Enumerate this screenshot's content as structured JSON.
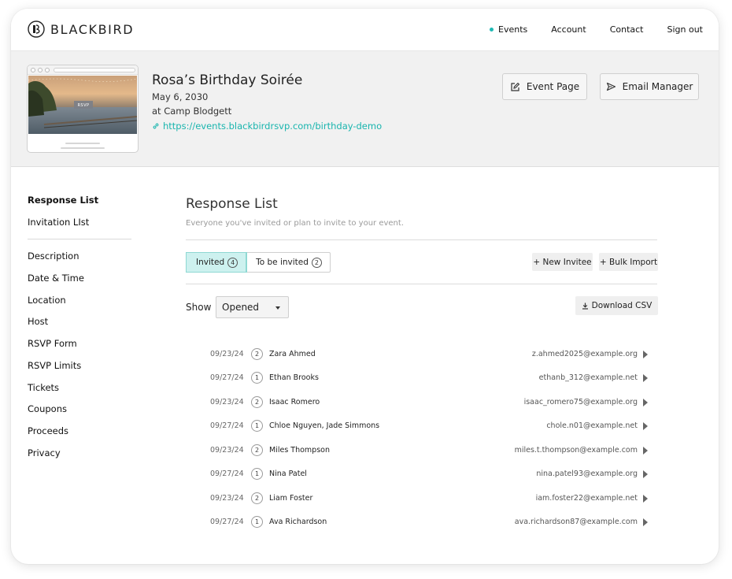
{
  "brand": {
    "name": "BLACKBIRD"
  },
  "nav": [
    {
      "label": "Events",
      "active": true
    },
    {
      "label": "Account"
    },
    {
      "label": "Contact"
    },
    {
      "label": "Sign out"
    }
  ],
  "event": {
    "thumbnail_badge": "RSVP",
    "title": "Rosa’s Birthday Soirée",
    "date": "May 6, 2030",
    "venue": "at Camp Blodgett",
    "url": "https://events.blackbirdrsvp.com/birthday-demo"
  },
  "header_buttons": {
    "event_page": "Event Page",
    "email_manager": "Email Manager"
  },
  "sidebar": {
    "primary": [
      {
        "label": "Response List",
        "active": true
      },
      {
        "label": "Invitation LIst"
      }
    ],
    "secondary": [
      {
        "label": "Description"
      },
      {
        "label": "Date & Time"
      },
      {
        "label": "Location"
      },
      {
        "label": "Host"
      },
      {
        "label": "RSVP Form"
      },
      {
        "label": "RSVP Limits"
      },
      {
        "label": "Tickets"
      },
      {
        "label": "Coupons"
      },
      {
        "label": "Proceeds"
      },
      {
        "label": "Privacy"
      }
    ]
  },
  "main": {
    "title": "Response List",
    "subtitle": "Everyone you've invited or plan to invite to your event.",
    "tabs": [
      {
        "label": "Invited",
        "count": "4",
        "active": true
      },
      {
        "label": "To be invited",
        "count": "2"
      }
    ],
    "new_invitee": "+ New Invitee",
    "bulk_import": "+ Bulk Import",
    "show_label": "Show",
    "filter_value": "Opened",
    "download_csv": "Download CSV"
  },
  "responses": [
    {
      "date": "09/23/24",
      "count": "2",
      "name": "Zara Ahmed",
      "email": "z.ahmed2025@example.org"
    },
    {
      "date": "09/27/24",
      "count": "1",
      "name": "Ethan Brooks",
      "email": "ethanb_312@example.net"
    },
    {
      "date": "09/23/24",
      "count": "2",
      "name": "Isaac Romero",
      "email": "isaac_romero75@example.org"
    },
    {
      "date": "09/27/24",
      "count": "1",
      "name": "Chloe Nguyen, Jade Simmons",
      "email": "chole.n01@example.net"
    },
    {
      "date": "09/23/24",
      "count": "2",
      "name": "Miles Thompson",
      "email": "miles.t.thompson@example.com"
    },
    {
      "date": "09/27/24",
      "count": "1",
      "name": "Nina Patel",
      "email": "nina.patel93@example.org"
    },
    {
      "date": "09/23/24",
      "count": "2",
      "name": "Liam Foster",
      "email": "iam.foster22@example.net"
    },
    {
      "date": "09/27/24",
      "count": "1",
      "name": "Ava Richardson",
      "email": "ava.richardson87@example.com"
    }
  ],
  "colors": {
    "accent": "#1fb9b4",
    "active_tab": "#cdf1ef",
    "header_bg": "#f1f1f1"
  }
}
